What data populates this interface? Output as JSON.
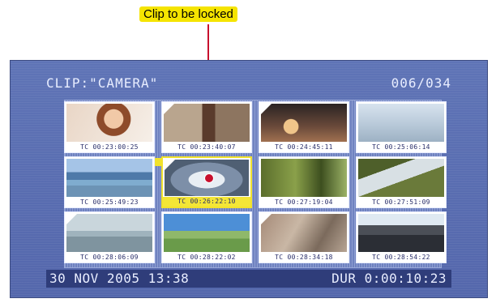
{
  "callout": {
    "label": "Clip to be locked"
  },
  "header": {
    "clip_title": "CLIP:\"CAMERA\"",
    "counter": "006/034"
  },
  "thumbnails": [
    {
      "tc": "TC 00:23:00:25",
      "marked": false,
      "selected": false
    },
    {
      "tc": "TC 00:23:40:07",
      "marked": true,
      "selected": false
    },
    {
      "tc": "TC 00:24:45:11",
      "marked": true,
      "selected": false
    },
    {
      "tc": "TC 00:25:06:14",
      "marked": false,
      "selected": false
    },
    {
      "tc": "TC 00:25:49:23",
      "marked": false,
      "selected": false
    },
    {
      "tc": "TC 00:26:22:10",
      "marked": true,
      "selected": true
    },
    {
      "tc": "TC 00:27:19:04",
      "marked": false,
      "selected": false
    },
    {
      "tc": "TC 00:27:51:09",
      "marked": false,
      "selected": false
    },
    {
      "tc": "TC 00:28:06:09",
      "marked": true,
      "selected": false
    },
    {
      "tc": "TC 00:28:22:02",
      "marked": false,
      "selected": false
    },
    {
      "tc": "TC 00:28:34:18",
      "marked": true,
      "selected": false
    },
    {
      "tc": "TC 00:28:54:22",
      "marked": false,
      "selected": false
    }
  ],
  "footer": {
    "date_time": "30 NOV 2005 13:38",
    "duration": "DUR  0:00:10:23"
  },
  "colors": {
    "screen": "#5a6db0",
    "highlight": "#f1e22c",
    "callout_line": "#c8102e"
  }
}
